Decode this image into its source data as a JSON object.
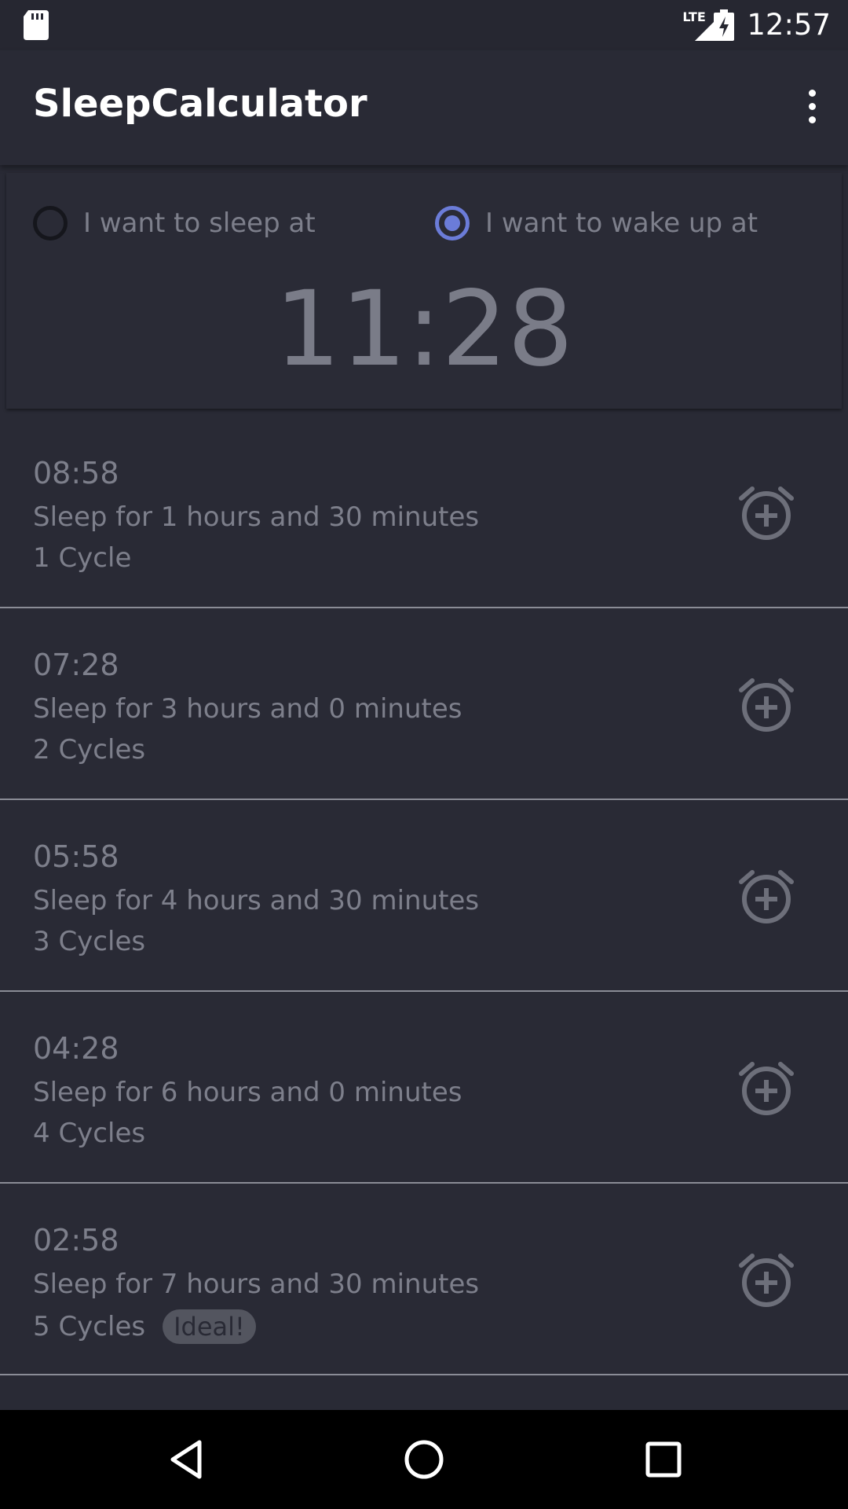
{
  "status_bar": {
    "network": "LTE",
    "clock": "12:57"
  },
  "app_bar": {
    "title": "SleepCalculator"
  },
  "mode": {
    "sleep_label": "I want to sleep at",
    "wake_label": "I want to wake up at",
    "selected": "wake"
  },
  "selected_time": "11:28",
  "results": [
    {
      "time": "08:58",
      "duration": "Sleep for 1 hours and 30 minutes",
      "cycles": "1 Cycle",
      "badge": ""
    },
    {
      "time": "07:28",
      "duration": "Sleep for 3 hours and 0 minutes",
      "cycles": "2 Cycles",
      "badge": ""
    },
    {
      "time": "05:58",
      "duration": "Sleep for 4 hours and 30 minutes",
      "cycles": "3 Cycles",
      "badge": ""
    },
    {
      "time": "04:28",
      "duration": "Sleep for 6 hours and 0 minutes",
      "cycles": "4 Cycles",
      "badge": ""
    },
    {
      "time": "02:58",
      "duration": "Sleep for 7 hours and 30 minutes",
      "cycles": "5 Cycles",
      "badge": "Ideal!"
    }
  ],
  "icons": {
    "sd_card": "sd-card-icon",
    "signal": "signal-icon",
    "battery": "battery-charging-icon",
    "overflow": "more-vert-icon",
    "alarm_add": "alarm-add-icon",
    "back": "back-icon",
    "home": "home-icon",
    "recents": "recents-icon"
  },
  "colors": {
    "background": "#292a35",
    "accent": "#6b7cd8",
    "text_muted": "#7d7f8b"
  }
}
